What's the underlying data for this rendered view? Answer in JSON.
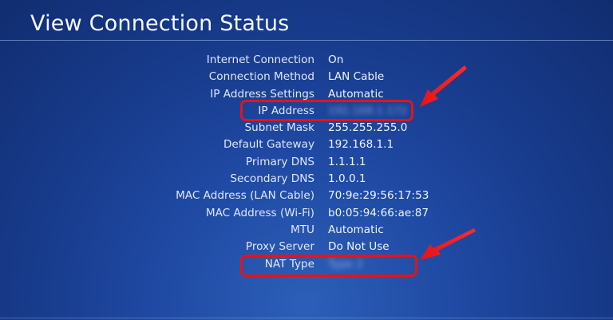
{
  "screen": {
    "title": "View Connection Status"
  },
  "rows": [
    {
      "label": "Internet Connection",
      "value": "On"
    },
    {
      "label": "Connection Method",
      "value": "LAN Cable"
    },
    {
      "label": "IP Address Settings",
      "value": "Automatic"
    },
    {
      "label": "IP Address",
      "value": "192.168.1.172"
    },
    {
      "label": "Subnet Mask",
      "value": "255.255.255.0"
    },
    {
      "label": "Default Gateway",
      "value": "192.168.1.1"
    },
    {
      "label": "Primary DNS",
      "value": "1.1.1.1"
    },
    {
      "label": "Secondary DNS",
      "value": "1.0.0.1"
    },
    {
      "label": "MAC Address (LAN Cable)",
      "value": "70:9e:29:56:17:53"
    },
    {
      "label": "MAC Address (Wi-Fi)",
      "value": "b0:05:94:66:ae:87"
    },
    {
      "label": "MTU",
      "value": "Automatic"
    },
    {
      "label": "Proxy Server",
      "value": "Do Not Use"
    },
    {
      "label": "NAT Type",
      "value": "Type 2"
    }
  ],
  "annotations": {
    "highlighted_rows": [
      "IP Address",
      "NAT Type"
    ],
    "highlight_color": "#e3141a"
  },
  "colors": {
    "background": "#1f49a3",
    "text": "#ffffff"
  }
}
